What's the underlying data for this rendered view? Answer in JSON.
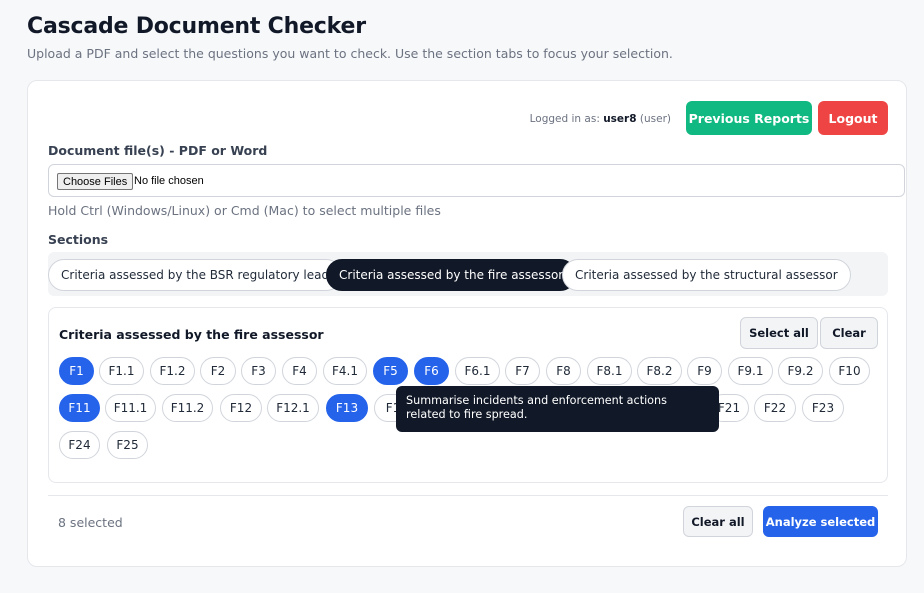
{
  "header": {
    "title": "Cascade Document Checker",
    "subtitle": "Upload a PDF and select the questions you want to check. Use the section tabs to focus your selection."
  },
  "session": {
    "logged_prefix": "Logged in as:",
    "username": "user8",
    "role": "(user)",
    "previous_reports_label": "Previous Reports",
    "logout_label": "Logout"
  },
  "upload": {
    "label": "Document file(s) - PDF or Word",
    "choose_label": "Choose Files",
    "no_file_text": "No file chosen",
    "hint": "Hold Ctrl (Windows/Linux) or Cmd (Mac) to select multiple files"
  },
  "sections": {
    "label": "Sections",
    "tabs": [
      {
        "label": "Criteria assessed by the BSR regulatory lead",
        "active": false
      },
      {
        "label": "Criteria assessed by the fire assessor",
        "active": true
      },
      {
        "label": "Criteria assessed by the structural assessor",
        "active": false
      }
    ]
  },
  "criteria": {
    "title": "Criteria assessed by the fire assessor",
    "select_all_label": "Select all",
    "clear_label": "Clear",
    "chips": [
      {
        "label": "F1",
        "selected": true
      },
      {
        "label": "F1.1",
        "selected": false
      },
      {
        "label": "F1.2",
        "selected": false
      },
      {
        "label": "F2",
        "selected": false
      },
      {
        "label": "F3",
        "selected": false
      },
      {
        "label": "F4",
        "selected": false
      },
      {
        "label": "F4.1",
        "selected": false
      },
      {
        "label": "F5",
        "selected": true
      },
      {
        "label": "F6",
        "selected": true
      },
      {
        "label": "F6.1",
        "selected": false
      },
      {
        "label": "F7",
        "selected": false
      },
      {
        "label": "F8",
        "selected": false
      },
      {
        "label": "F8.1",
        "selected": false
      },
      {
        "label": "F8.2",
        "selected": false
      },
      {
        "label": "F9",
        "selected": false
      },
      {
        "label": "F9.1",
        "selected": false
      },
      {
        "label": "F9.2",
        "selected": false
      },
      {
        "label": "F10",
        "selected": false
      },
      {
        "label": "F11",
        "selected": true
      },
      {
        "label": "F11.1",
        "selected": false
      },
      {
        "label": "F11.2",
        "selected": false
      },
      {
        "label": "F12",
        "selected": false
      },
      {
        "label": "F12.1",
        "selected": false
      },
      {
        "label": "F13",
        "selected": true
      },
      {
        "label": "F1",
        "selected": false
      },
      {
        "label": "F21",
        "selected": false
      },
      {
        "label": "F22",
        "selected": false
      },
      {
        "label": "F23",
        "selected": false
      },
      {
        "label": "F24",
        "selected": false
      },
      {
        "label": "F25",
        "selected": false
      }
    ],
    "tooltip": "Summarise incidents and enforcement actions related to fire spread."
  },
  "footer": {
    "selected_count": "8 selected",
    "clear_all_label": "Clear all",
    "analyze_label": "Analyze selected"
  },
  "colors": {
    "accent": "#2563eb",
    "success": "#10b981",
    "danger": "#ef4444",
    "dark": "#111827"
  }
}
